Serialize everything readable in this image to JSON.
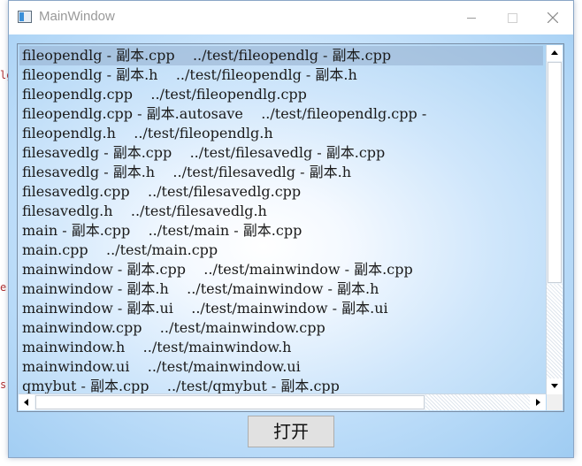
{
  "window": {
    "title": "MainWindow"
  },
  "file_list": {
    "items": [
      "fileopendlg - 副本.cpp    ../test/fileopendlg - 副本.cpp",
      "fileopendlg - 副本.h    ../test/fileopendlg - 副本.h",
      "fileopendlg.cpp    ../test/fileopendlg.cpp",
      "fileopendlg.cpp - 副本.autosave    ../test/fileopendlg.cpp -",
      "fileopendlg.h    ../test/fileopendlg.h",
      "filesavedlg - 副本.cpp    ../test/filesavedlg - 副本.cpp",
      "filesavedlg - 副本.h    ../test/filesavedlg - 副本.h",
      "filesavedlg.cpp    ../test/filesavedlg.cpp",
      "filesavedlg.h    ../test/filesavedlg.h",
      "main - 副本.cpp    ../test/main - 副本.cpp",
      "main.cpp    ../test/main.cpp",
      "mainwindow - 副本.cpp    ../test/mainwindow - 副本.cpp",
      "mainwindow - 副本.h    ../test/mainwindow - 副本.h",
      "mainwindow - 副本.ui    ../test/mainwindow - 副本.ui",
      "mainwindow.cpp    ../test/mainwindow.cpp",
      "mainwindow.h    ../test/mainwindow.h",
      "mainwindow.ui    ../test/mainwindow.ui",
      "qmybut - 副本.cpp    ../test/qmybut - 副本.cpp"
    ],
    "selected_index": 0
  },
  "open_button": {
    "label": "打开"
  },
  "colors": {
    "selection": "#96afcd",
    "client_gradient_center": "#ffffff",
    "client_gradient_edge": "#9fccf2"
  }
}
